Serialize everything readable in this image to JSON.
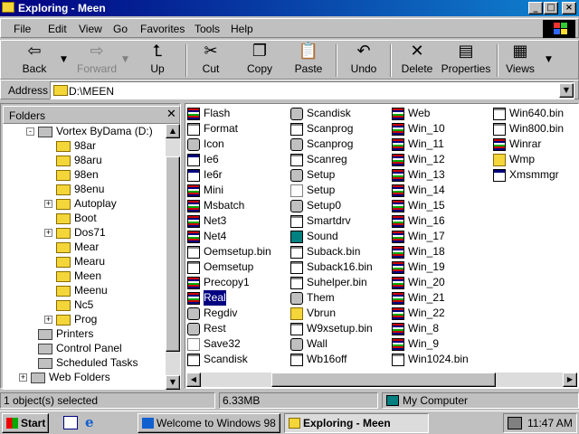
{
  "window": {
    "title": "Exploring - Meen",
    "buttons": {
      "minimize": "_",
      "maximize": "□",
      "close": "×"
    }
  },
  "menu": [
    "File",
    "Edit",
    "View",
    "Go",
    "Favorites",
    "Tools",
    "Help"
  ],
  "toolbar": {
    "back": "Back",
    "forward": "Forward",
    "up": "Up",
    "cut": "Cut",
    "copy": "Copy",
    "paste": "Paste",
    "undo": "Undo",
    "delete": "Delete",
    "properties": "Properties",
    "views": "Views"
  },
  "address": {
    "label": "Address",
    "value": "D:\\MEEN"
  },
  "folders": {
    "title": "Folders",
    "items": [
      {
        "label": "Vortex  ByDama (D:)",
        "level": 0,
        "expander": "-",
        "icon": "drive-icon"
      },
      {
        "label": "98ar",
        "level": 1,
        "expander": "",
        "icon": "folder-icon"
      },
      {
        "label": "98aru",
        "level": 1,
        "expander": "",
        "icon": "folder-icon"
      },
      {
        "label": "98en",
        "level": 1,
        "expander": "",
        "icon": "folder-icon"
      },
      {
        "label": "98enu",
        "level": 1,
        "expander": "",
        "icon": "folder-icon"
      },
      {
        "label": "Autoplay",
        "level": 1,
        "expander": "+",
        "icon": "folder-icon"
      },
      {
        "label": "Boot",
        "level": 1,
        "expander": "",
        "icon": "folder-icon"
      },
      {
        "label": "Dos71",
        "level": 1,
        "expander": "+",
        "icon": "folder-icon"
      },
      {
        "label": "Mear",
        "level": 1,
        "expander": "",
        "icon": "folder-icon"
      },
      {
        "label": "Mearu",
        "level": 1,
        "expander": "",
        "icon": "folder-icon"
      },
      {
        "label": "Meen",
        "level": 1,
        "expander": "",
        "icon": "open-folder-icon"
      },
      {
        "label": "Meenu",
        "level": 1,
        "expander": "",
        "icon": "folder-icon"
      },
      {
        "label": "Nc5",
        "level": 1,
        "expander": "",
        "icon": "folder-icon"
      },
      {
        "label": "Prog",
        "level": 1,
        "expander": "+",
        "icon": "folder-icon"
      },
      {
        "label": "Printers",
        "level": 0,
        "expander": "",
        "icon": "printers-icon"
      },
      {
        "label": "Control Panel",
        "level": 0,
        "expander": "",
        "icon": "control-panel-icon"
      },
      {
        "label": "Scheduled Tasks",
        "level": 0,
        "expander": "",
        "icon": "scheduled-tasks-icon"
      },
      {
        "label": "Web Folders",
        "level": -1,
        "expander": "+",
        "icon": "web-folders-icon"
      }
    ]
  },
  "files": {
    "columns": [
      [
        {
          "name": "Flash",
          "type": "stripe"
        },
        {
          "name": "Format",
          "type": "bat"
        },
        {
          "name": "Icon",
          "type": "gear"
        },
        {
          "name": "Ie6",
          "type": "exe"
        },
        {
          "name": "Ie6r",
          "type": "exe"
        },
        {
          "name": "Mini",
          "type": "stripe"
        },
        {
          "name": "Msbatch",
          "type": "stripe"
        },
        {
          "name": "Net3",
          "type": "stripe"
        },
        {
          "name": "Net4",
          "type": "stripe"
        },
        {
          "name": "Oemsetup.bin",
          "type": "bat"
        },
        {
          "name": "Oemsetup",
          "type": "bat"
        },
        {
          "name": "Precopy1",
          "type": "stripe"
        },
        {
          "name": "Real",
          "type": "stripe",
          "selected": true
        },
        {
          "name": "Regdiv",
          "type": "gear"
        },
        {
          "name": "Rest",
          "type": "gear"
        },
        {
          "name": "Save32",
          "type": "doc"
        },
        {
          "name": "Scandisk",
          "type": "bat"
        }
      ],
      [
        {
          "name": "Scandisk",
          "type": "gear"
        },
        {
          "name": "Scanprog",
          "type": "bat"
        },
        {
          "name": "Scanprog",
          "type": "gear"
        },
        {
          "name": "Scanreg",
          "type": "bat"
        },
        {
          "name": "Setup",
          "type": "gear"
        },
        {
          "name": "Setup",
          "type": "doc"
        },
        {
          "name": "Setup0",
          "type": "gear"
        },
        {
          "name": "Smartdrv",
          "type": "bat"
        },
        {
          "name": "Sound",
          "type": "mon"
        },
        {
          "name": "Suback.bin",
          "type": "bat"
        },
        {
          "name": "Suback16.bin",
          "type": "bat"
        },
        {
          "name": "Suhelper.bin",
          "type": "bat"
        },
        {
          "name": "Them",
          "type": "gear"
        },
        {
          "name": "Vbrun",
          "type": "folder"
        },
        {
          "name": "W9xsetup.bin",
          "type": "bat"
        },
        {
          "name": "Wall",
          "type": "gear"
        },
        {
          "name": "Wb16off",
          "type": "bat"
        }
      ],
      [
        {
          "name": "Web",
          "type": "stripe"
        },
        {
          "name": "Win_10",
          "type": "stripe"
        },
        {
          "name": "Win_11",
          "type": "stripe"
        },
        {
          "name": "Win_12",
          "type": "stripe"
        },
        {
          "name": "Win_13",
          "type": "stripe"
        },
        {
          "name": "Win_14",
          "type": "stripe"
        },
        {
          "name": "Win_15",
          "type": "stripe"
        },
        {
          "name": "Win_16",
          "type": "stripe"
        },
        {
          "name": "Win_17",
          "type": "stripe"
        },
        {
          "name": "Win_18",
          "type": "stripe"
        },
        {
          "name": "Win_19",
          "type": "stripe"
        },
        {
          "name": "Win_20",
          "type": "stripe"
        },
        {
          "name": "Win_21",
          "type": "stripe"
        },
        {
          "name": "Win_22",
          "type": "stripe"
        },
        {
          "name": "Win_8",
          "type": "stripe"
        },
        {
          "name": "Win_9",
          "type": "stripe"
        },
        {
          "name": "Win1024.bin",
          "type": "bat"
        }
      ],
      [
        {
          "name": "Win640.bin",
          "type": "bat"
        },
        {
          "name": "Win800.bin",
          "type": "bat"
        },
        {
          "name": "Winrar",
          "type": "stripe"
        },
        {
          "name": "Wmp",
          "type": "folder"
        },
        {
          "name": "Xmsmmgr",
          "type": "exe"
        }
      ]
    ]
  },
  "status": {
    "selection": "1 object(s) selected",
    "size": "6.33MB",
    "location": "My Computer"
  },
  "taskbar": {
    "start": "Start",
    "tasks": [
      "Welcome to Windows 98",
      "Exploring - Meen"
    ],
    "clock": "11:47 AM"
  }
}
